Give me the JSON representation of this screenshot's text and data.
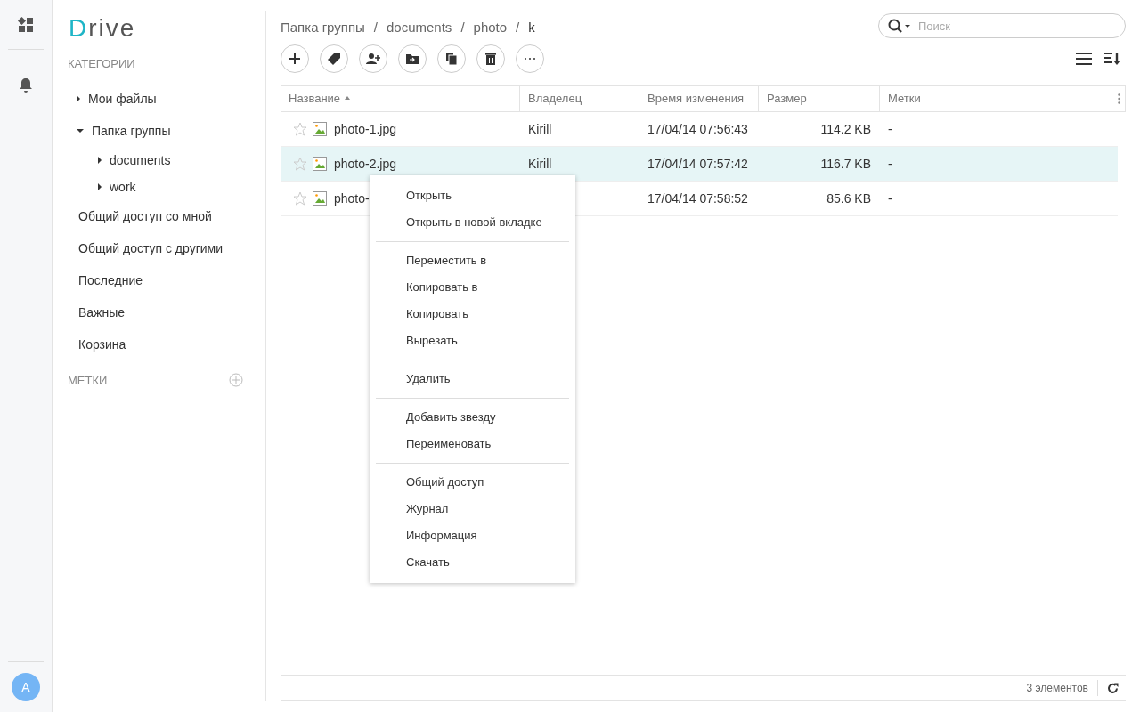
{
  "rail": {
    "avatar": "A"
  },
  "sidebar": {
    "logo": "Drive",
    "categories_title": "КАТЕГОРИИ",
    "tree": [
      {
        "label": "Мои файлы",
        "expanded": false
      },
      {
        "label": "Папка группы",
        "expanded": true,
        "children": [
          {
            "label": "documents",
            "expanded": false
          },
          {
            "label": "work",
            "expanded": false
          }
        ]
      }
    ],
    "items": [
      "Общий доступ со мной",
      "Общий доступ с другими",
      "Последние",
      "Важные",
      "Корзина"
    ],
    "tags_title": "МЕТКИ"
  },
  "breadcrumbs": [
    "Папка группы",
    "documents",
    "photo",
    "k"
  ],
  "breadcrumb_separator": "/",
  "search": {
    "placeholder": "Поиск"
  },
  "table": {
    "columns": [
      {
        "label": "Название",
        "sorted": true
      },
      {
        "label": "Владелец",
        "sorted": false
      },
      {
        "label": "Время изменения",
        "sorted": false
      },
      {
        "label": "Размер",
        "sorted": false
      },
      {
        "label": "Метки",
        "sorted": false
      }
    ],
    "rows": [
      {
        "name": "photo-1.jpg",
        "owner": "Kirill",
        "modified": "17/04/14 07:56:43",
        "size": "114.2 KB",
        "tags": "-",
        "selected": false
      },
      {
        "name": "photo-2.jpg",
        "owner": "Kirill",
        "modified": "17/04/14 07:57:42",
        "size": "116.7 KB",
        "tags": "-",
        "selected": true
      },
      {
        "name": "photo-",
        "modified": "17/04/14 07:58:52",
        "size": "85.6 KB",
        "tags": "-",
        "selected": false
      }
    ]
  },
  "context_menu": [
    [
      "Открыть",
      "Открыть в новой вкладке"
    ],
    [
      "Переместить в",
      "Копировать в",
      "Копировать",
      "Вырезать"
    ],
    [
      "Удалить"
    ],
    [
      "Добавить звезду",
      "Переименовать"
    ],
    [
      "Общий доступ",
      "Журнал",
      "Информация",
      "Скачать"
    ]
  ],
  "status": "3 элементов"
}
